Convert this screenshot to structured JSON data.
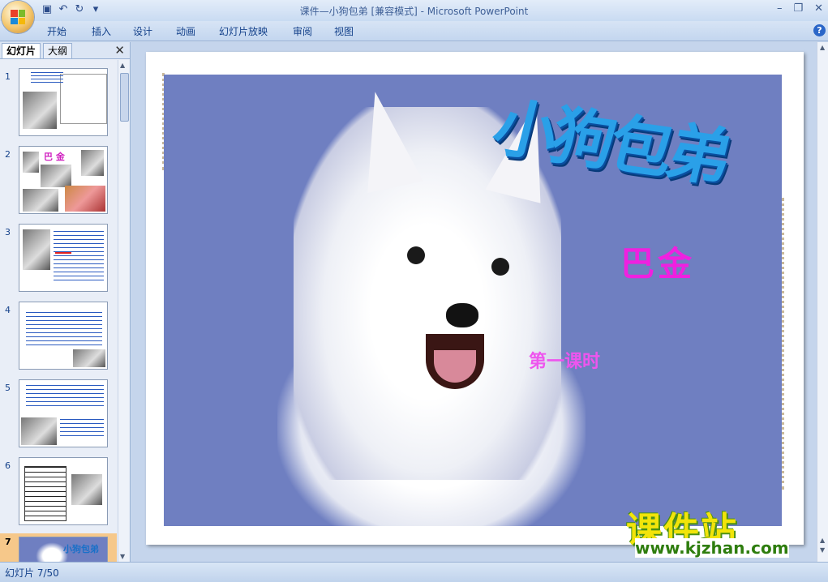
{
  "app": {
    "title": "课件—小狗包弟 [兼容模式] - Microsoft PowerPoint"
  },
  "qat": [
    "save-icon",
    "undo-icon",
    "redo-icon",
    "customize-icon"
  ],
  "window_controls": [
    "minimize",
    "restore",
    "close"
  ],
  "ribbon": {
    "tabs": [
      "开始",
      "插入",
      "设计",
      "动画",
      "幻灯片放映",
      "审阅",
      "视图"
    ]
  },
  "left_pane": {
    "tab_slides": "幻灯片",
    "tab_outline": "大纲",
    "close": "✕",
    "slides": [
      {
        "num": "1"
      },
      {
        "num": "2",
        "heading": "巴 金"
      },
      {
        "num": "3"
      },
      {
        "num": "4"
      },
      {
        "num": "5"
      },
      {
        "num": "6"
      },
      {
        "num": "7",
        "heading": "小狗包弟",
        "selected": true
      }
    ]
  },
  "slide": {
    "title": "小狗包弟",
    "author": "巴金",
    "subtitle": "第一课时"
  },
  "watermark": {
    "brand": "课件站",
    "url": "www.kjzhan.com"
  },
  "status": {
    "slide_info": "幻灯片 7/50"
  },
  "colors": {
    "slide_bg": "#6f7fc1",
    "title_blue": "#2aa0e8",
    "author_magenta": "#f020e0",
    "subtitle_pink": "#ee55ee",
    "selected_thumb": "#f6c88a"
  }
}
